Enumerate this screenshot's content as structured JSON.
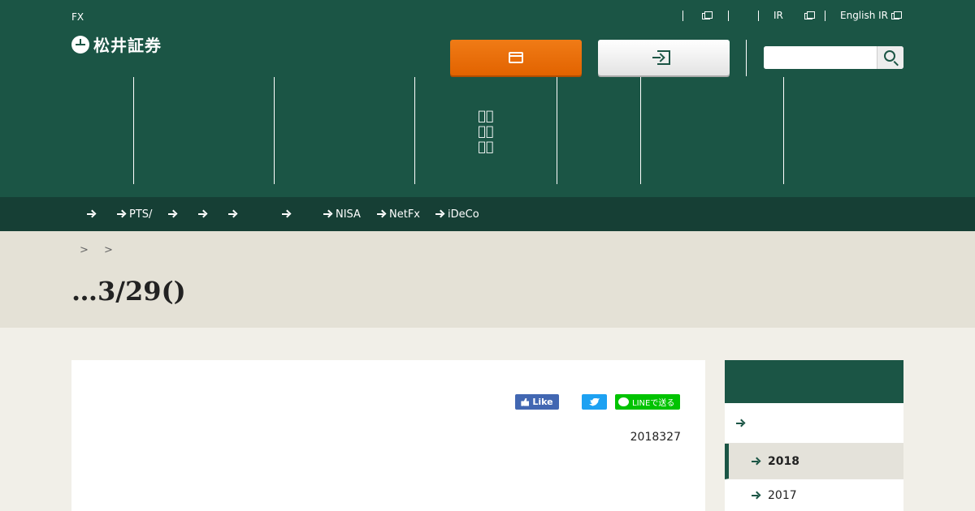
{
  "header": {
    "fx_label": "FX",
    "logo_text": "松井証券",
    "util_links": [
      {
        "label": ""
      },
      {
        "label": ""
      },
      {
        "label": "IR"
      },
      {
        "label": "English IR"
      }
    ],
    "open_account_button": "",
    "login_button": "",
    "search": {
      "value": "",
      "placeholder": ""
    },
    "main_nav": [
      {
        "label": ""
      },
      {
        "label": ""
      },
      {
        "label": ""
      },
      {
        "label": "\u0000\u0000\n\u0000\u0000\n\u0000\u0000"
      },
      {
        "label": ""
      },
      {
        "label": ""
      },
      {
        "label": ""
      }
    ]
  },
  "subnav": {
    "items": [
      {
        "label": ""
      },
      {
        "label": "PTS/"
      },
      {
        "label": ""
      },
      {
        "label": ""
      },
      {
        "label": ""
      },
      {
        "label": ""
      },
      {
        "label": "NISA"
      },
      {
        "label": "NetFx"
      },
      {
        "label": "iDeCo"
      }
    ]
  },
  "breadcrumb": {
    "separators": [
      ">",
      ">"
    ]
  },
  "page": {
    "title": "…3/29()"
  },
  "article": {
    "like_label": "Like",
    "line_label": "LINEで送る",
    "date": "2018327"
  },
  "sidebar": {
    "heading": "",
    "items": [
      {
        "label": ""
      },
      {
        "label": "2018"
      },
      {
        "label": "2017"
      }
    ]
  },
  "colors": {
    "brand_green": "#1b5545",
    "subnav_green": "#163f35",
    "accent_orange": "#e26300",
    "banner_beige": "#e4e1d6"
  }
}
